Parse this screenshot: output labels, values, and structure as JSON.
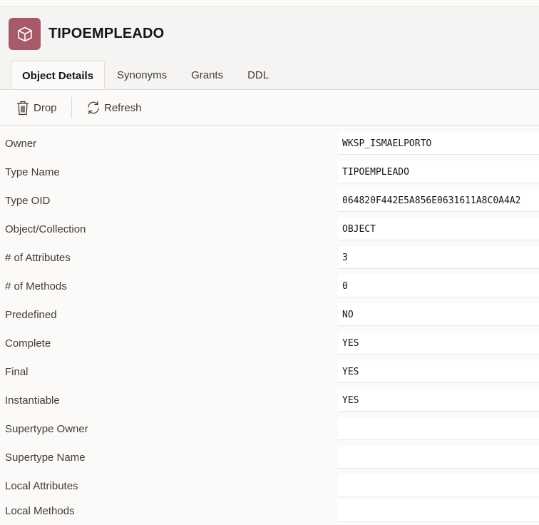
{
  "header": {
    "title": "TIPOEMPLEADO",
    "icon": "cube-icon",
    "icon_color": "#a65b6b"
  },
  "tabs": [
    {
      "label": "Object Details",
      "active": true
    },
    {
      "label": "Synonyms",
      "active": false
    },
    {
      "label": "Grants",
      "active": false
    },
    {
      "label": "DDL",
      "active": false
    }
  ],
  "toolbar": {
    "drop_label": "Drop",
    "refresh_label": "Refresh"
  },
  "details": [
    {
      "label": "Owner",
      "value": "WKSP_ISMAELPORTO"
    },
    {
      "label": "Type Name",
      "value": "TIPOEMPLEADO"
    },
    {
      "label": "Type OID",
      "value": "064820F442E5A856E0631611A8C0A4A2"
    },
    {
      "label": "Object/Collection",
      "value": "OBJECT"
    },
    {
      "label": "# of Attributes",
      "value": "3"
    },
    {
      "label": "# of Methods",
      "value": "0"
    },
    {
      "label": "Predefined",
      "value": "NO"
    },
    {
      "label": "Complete",
      "value": "YES"
    },
    {
      "label": "Final",
      "value": "YES"
    },
    {
      "label": "Instantiable",
      "value": "YES"
    },
    {
      "label": "Supertype Owner",
      "value": ""
    },
    {
      "label": "Supertype Name",
      "value": ""
    },
    {
      "label": "Local Attributes",
      "value": ""
    },
    {
      "label": "Local Methods",
      "value": ""
    }
  ]
}
